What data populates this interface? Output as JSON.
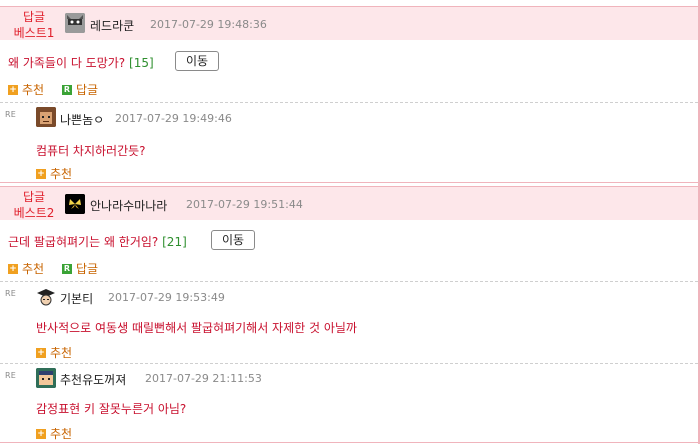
{
  "best1": {
    "label_line1": "답글",
    "label_line2": "베스트1",
    "nick": "레드라쿤",
    "date": "2017-07-29 19:48:36",
    "content": "왜 가족들이 다 도망가?",
    "count": "[15]",
    "move_label": "이동",
    "recommend_label": "추천",
    "reply_label": "답글"
  },
  "reply1": {
    "re_mark": "RE",
    "nick": "나쁜놈ㅇ",
    "date": "2017-07-29 19:49:46",
    "content": "컴퓨터 차지하러간듯?",
    "recommend_label": "추천"
  },
  "best2": {
    "label_line1": "답글",
    "label_line2": "베스트2",
    "nick": "안나라수마나라",
    "date": "2017-07-29 19:51:44",
    "content": "근데 팔굽혀펴기는 왜 한거임?",
    "count": "[21]",
    "move_label": "이동",
    "recommend_label": "추천",
    "reply_label": "답글"
  },
  "reply2": {
    "re_mark": "RE",
    "nick": "기본티",
    "date": "2017-07-29 19:53:49",
    "content": "반사적으로 여동생 때릴뻔해서 팔굽혀펴기해서 자제한 것 아닐까",
    "recommend_label": "추천"
  },
  "reply3": {
    "re_mark": "RE",
    "nick": "추천유도꺼져",
    "date": "2017-07-29 21:11:53",
    "content": "감정표현 키 잘못누른거 아님?",
    "recommend_label": "추천"
  },
  "colors": {
    "best_bg": "#fde7ea",
    "accent_red": "#c8102e",
    "count_green": "#2f8f2f",
    "action_orange": "#c86400"
  }
}
